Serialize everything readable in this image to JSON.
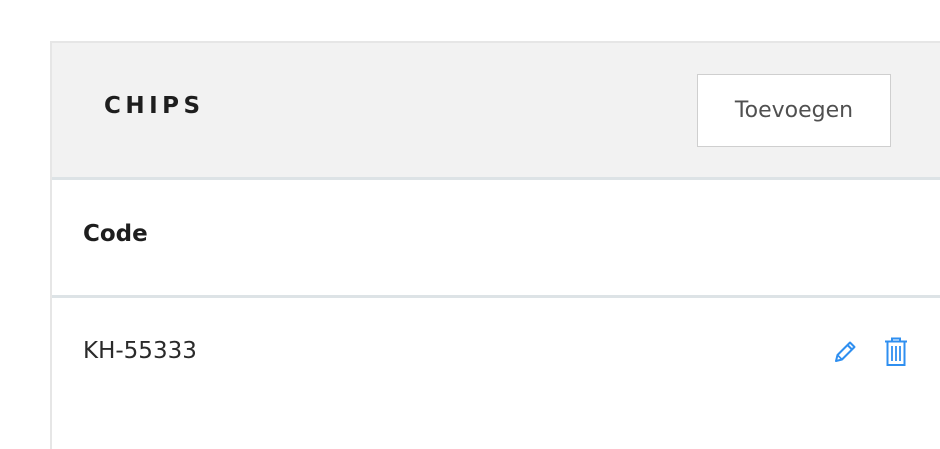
{
  "panel": {
    "title": "CHIPS",
    "add_button_label": "Toevoegen"
  },
  "table": {
    "columns": [
      "Code"
    ],
    "rows": [
      {
        "code": "KH-55333"
      }
    ]
  },
  "icons": {
    "edit": "pencil-icon",
    "delete": "trash-icon"
  },
  "colors": {
    "accent": "#2f8ff0",
    "header_bg": "#f2f2f2"
  }
}
